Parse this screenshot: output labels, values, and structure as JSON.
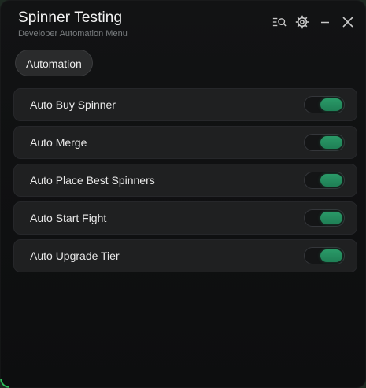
{
  "window": {
    "title": "Spinner Testing",
    "subtitle": "Developer Automation Menu",
    "accent_color": "#2fbf5b"
  },
  "titlebar_icons": [
    {
      "name": "search-list-icon"
    },
    {
      "name": "settings-icon"
    },
    {
      "name": "minimize-icon"
    },
    {
      "name": "close-icon"
    }
  ],
  "tabs": [
    {
      "label": "Automation",
      "active": true
    }
  ],
  "toggles": [
    {
      "label": "Auto Buy Spinner",
      "on": true
    },
    {
      "label": "Auto Merge",
      "on": true
    },
    {
      "label": "Auto Place Best Spinners",
      "on": true
    },
    {
      "label": "Auto Start Fight",
      "on": true
    },
    {
      "label": "Auto Upgrade Tier",
      "on": true
    }
  ],
  "toggle_on_color": "#248c5f"
}
